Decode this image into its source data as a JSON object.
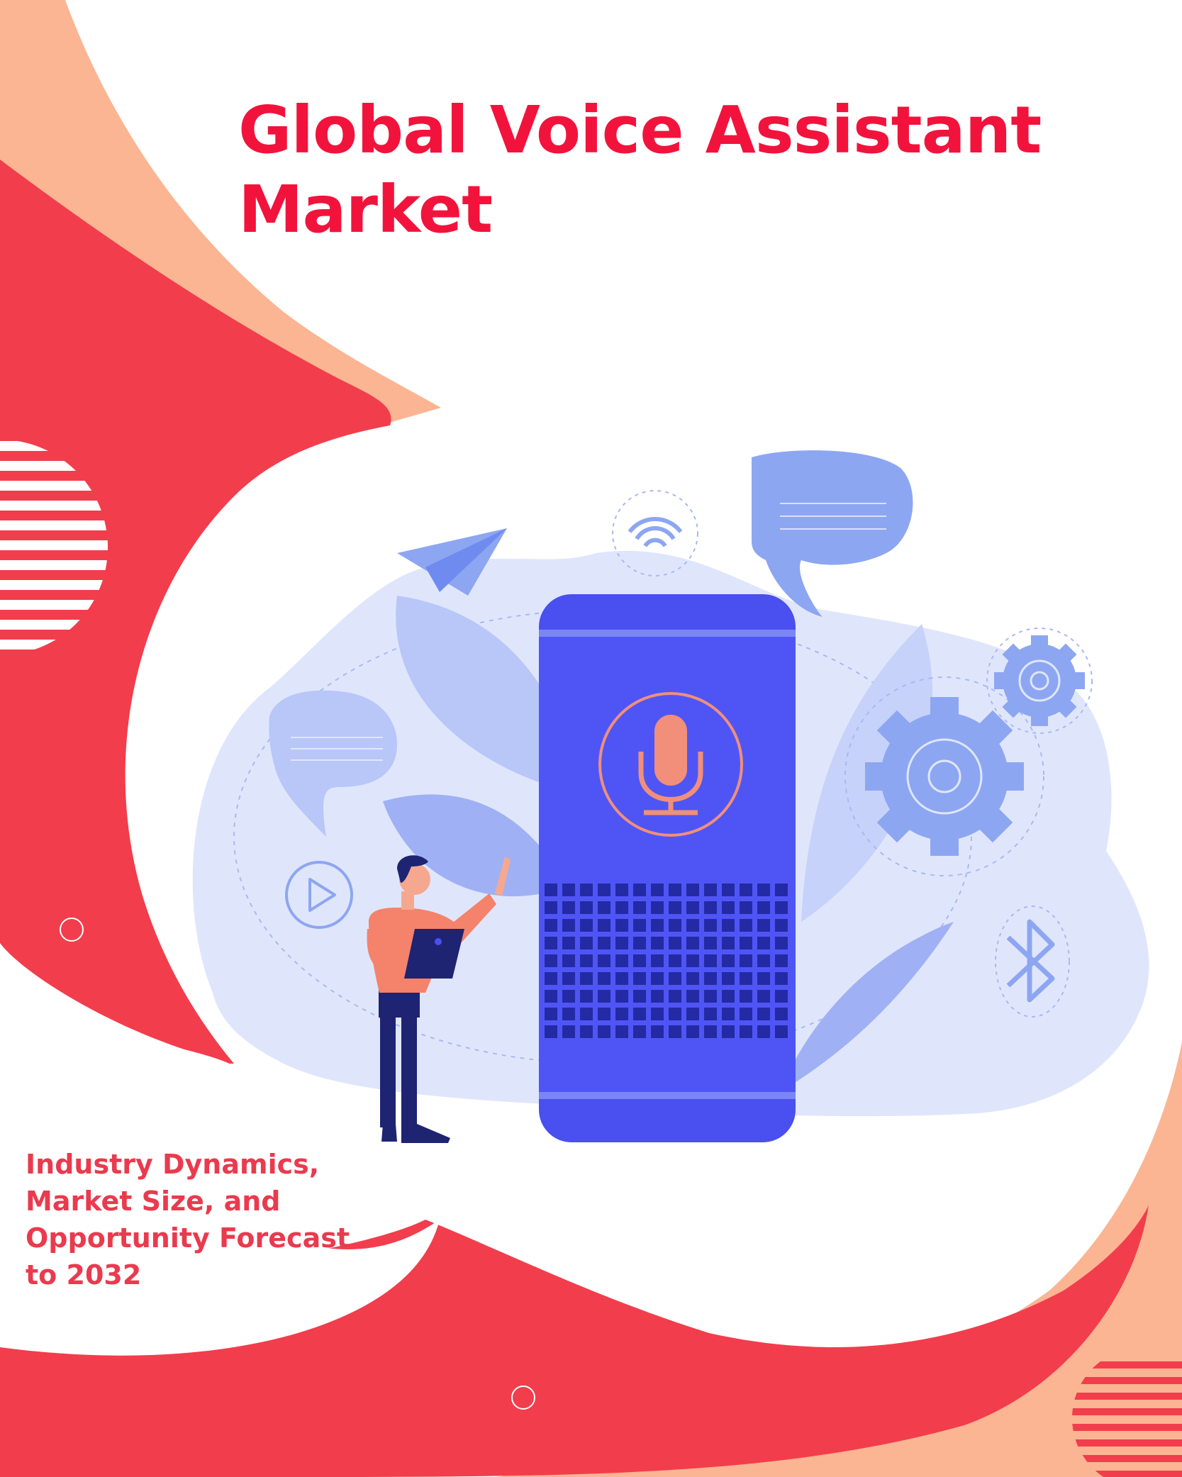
{
  "cover": {
    "title_lines": [
      "Global Voice Assistant",
      "Market"
    ],
    "subtitle_lines": [
      "Industry Dynamics,",
      "Market Size, and",
      "Opportunity Forecast",
      "to 2032"
    ]
  },
  "colors": {
    "accent_red": "#f2133c",
    "subtitle_red": "#ea3a4e",
    "shape_red": "#f23d4c",
    "shape_peach": "#fbb592",
    "device_blue": "#4a4ff0",
    "light_blue": "#dfe6fc",
    "mic_salmon": "#f28f7a"
  },
  "illustration": {
    "icons": [
      "microphone-icon",
      "wifi-icon",
      "paper-plane-icon",
      "play-icon",
      "gear-icon",
      "bluetooth-icon",
      "chat-bubble-icon"
    ]
  }
}
